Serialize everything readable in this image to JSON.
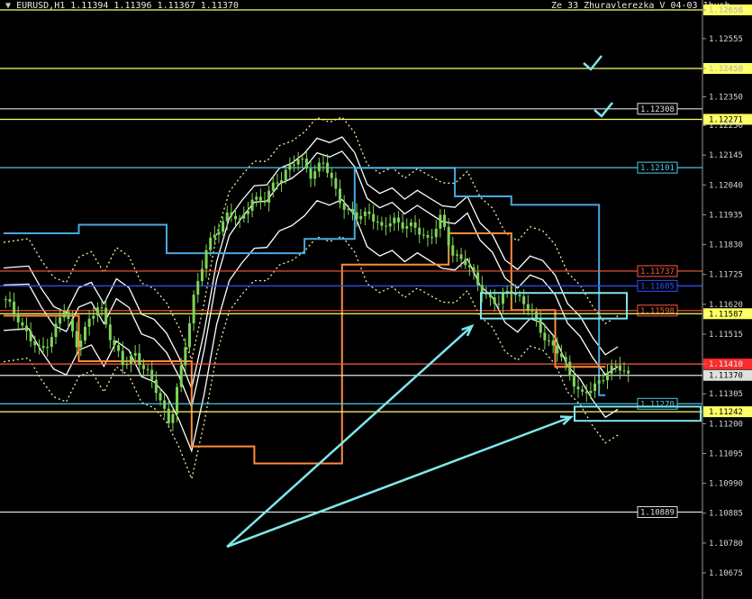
{
  "header": {
    "symbol_info": "EURUSD,H1  1.11394 1.11396 1.11367 1.11370",
    "indicator_name": "Ze_33_Zhuravlerezka_V_04-03_1bush"
  },
  "colors": {
    "background": "#000000",
    "candles": "#7fd35a",
    "level_yellow": "#ffff66",
    "level_blue": "#4fc6e8",
    "level_red": "#ff5b3b",
    "level_navy": "#2f4fff",
    "envelope": "#ffffff",
    "channel_blue": "#4aa8e0",
    "channel_orange": "#ff8c3a",
    "annotation": "#7fe7ea",
    "price_marker": "#ff2a2a"
  },
  "chart_data": {
    "type": "candlestick",
    "symbol": "EURUSD",
    "timeframe": "H1",
    "last_ohlc": {
      "open": 1.11394,
      "high": 1.11396,
      "low": 1.11367,
      "close": 1.1137
    },
    "ylim": [
      1.1062,
      1.1271
    ],
    "grid": false,
    "y_ticks": [
      "1.12656",
      "1.12555",
      "1.12450",
      "1.12350",
      "1.12250",
      "1.12145",
      "1.12040",
      "1.11935",
      "1.11830",
      "1.11725",
      "1.11620",
      "1.11515",
      "1.11410",
      "1.11305",
      "1.11200",
      "1.11095",
      "1.10990",
      "1.10885",
      "1.10780",
      "1.10675"
    ],
    "horizontal_levels": [
      {
        "price": 1.12656,
        "label": "1.12656",
        "color": "yellow",
        "label_style": "axis"
      },
      {
        "price": 1.1245,
        "label": "1.12450",
        "color": "yellow",
        "label_style": "axis"
      },
      {
        "price": 1.12308,
        "label": "1.12308",
        "color": "white",
        "label_style": "box"
      },
      {
        "price": 1.12271,
        "label": "1.12271",
        "color": "yellow",
        "label_style": "axis"
      },
      {
        "price": 1.12101,
        "label": "1.12101",
        "color": "blue",
        "label_style": "box"
      },
      {
        "price": 1.11737,
        "label": "1.11737",
        "color": "red",
        "label_style": "box"
      },
      {
        "price": 1.11685,
        "label": "1.11685",
        "color": "navy",
        "label_style": "box"
      },
      {
        "price": 1.11598,
        "label": "1.11598",
        "color": "red",
        "label_style": "box"
      },
      {
        "price": 1.11587,
        "label": "1.11587",
        "color": "yellow",
        "label_style": "axis"
      },
      {
        "price": 1.1141,
        "label": "1.11410",
        "color": "red",
        "label_style": "marker"
      },
      {
        "price": 1.1137,
        "label": "1.11370",
        "color": "white",
        "label_style": "axis"
      },
      {
        "price": 1.1127,
        "label": "1.11270",
        "color": "blue",
        "label_style": "box"
      },
      {
        "price": 1.11242,
        "label": "1.11242",
        "color": "yellow",
        "label_style": "axis"
      },
      {
        "price": 1.10889,
        "label": "1.10889",
        "color": "white",
        "label_style": "box"
      }
    ],
    "trendline_price_path": [
      1.1163,
      1.1158,
      1.115,
      1.1145,
      1.1152,
      1.116,
      1.1148,
      1.1155,
      1.1162,
      1.115,
      1.114,
      1.1145,
      1.1138,
      1.113,
      1.112,
      1.114,
      1.1165,
      1.118,
      1.1188,
      1.1195,
      1.119,
      1.12,
      1.1198,
      1.1205,
      1.121,
      1.1213,
      1.1208,
      1.1212,
      1.1203,
      1.1195,
      1.1192,
      1.1195,
      1.1188,
      1.1192,
      1.119,
      1.1188,
      1.1185,
      1.1192,
      1.118,
      1.1178,
      1.117,
      1.1165,
      1.1162,
      1.1168,
      1.1163,
      1.1157,
      1.115,
      1.1145,
      1.1138,
      1.113,
      1.1132,
      1.1138,
      1.114,
      1.1137
    ],
    "annotations": [
      "checkmark",
      "checkmark",
      "box",
      "box",
      "arrow",
      "arrow"
    ]
  }
}
